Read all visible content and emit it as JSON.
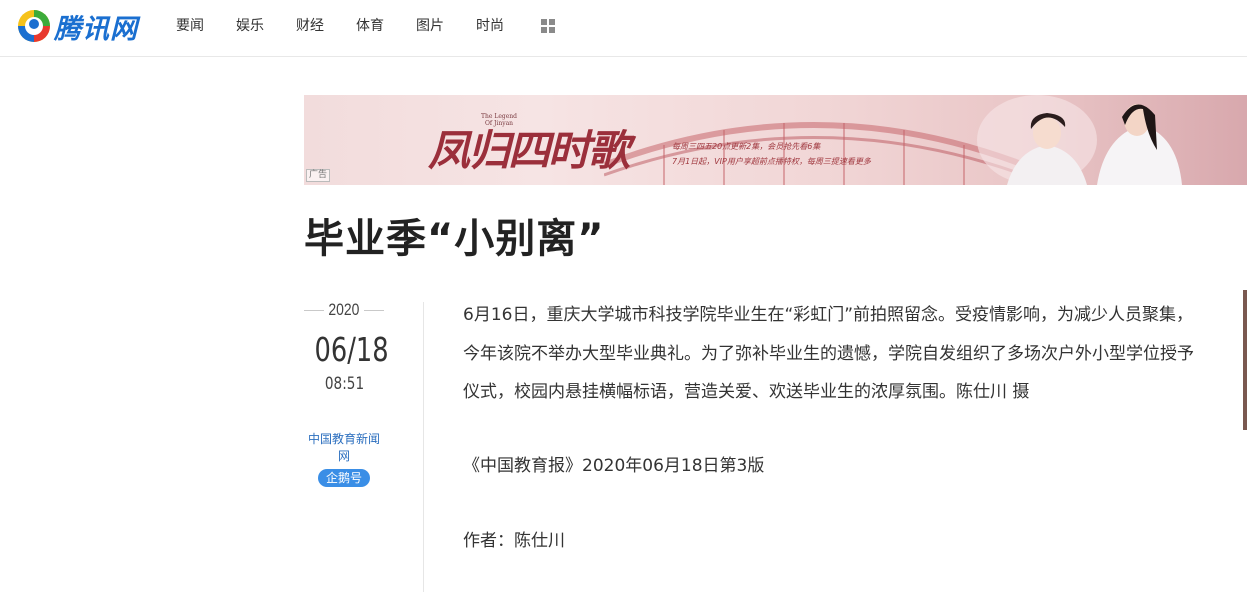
{
  "header": {
    "logo_text": "腾讯网",
    "nav": [
      "要闻",
      "娱乐",
      "财经",
      "体育",
      "图片",
      "时尚"
    ],
    "more_icon": "grid-icon"
  },
  "banner": {
    "title": "凤归四时歌",
    "subtitle": "The Legend Of Jinyan",
    "line1": "每周三四五20点更新2集，会员抢先看6集",
    "line2": "7月1日起，VIP用户享超前点播特权，每周三提速看更多",
    "ad_label": "广告"
  },
  "article": {
    "title": "毕业季“小别离”",
    "year": "2020",
    "date": "06/18",
    "time": "08:51",
    "source": "中国教育新闻网",
    "badge": "企鹅号",
    "body": "6月16日，重庆大学城市科技学院毕业生在“彩虹门”前拍照留念。受疫情影响，为减少人员聚集，今年该院不举办大型毕业典礼。为了弥补毕业生的遗憾，学院自发组织了多场次户外小型学位授予仪式，校园内悬挂横幅标语，营造关爱、欢送毕业生的浓厚氛围。陈仕川 摄",
    "print_source": "《中国教育报》2020年06月18日第3版",
    "author": "作者：陈仕川"
  },
  "colors": {
    "brand_blue": "#1a6fd0",
    "badge_blue": "#3a8ee6",
    "source_blue": "#2c6fbf"
  }
}
